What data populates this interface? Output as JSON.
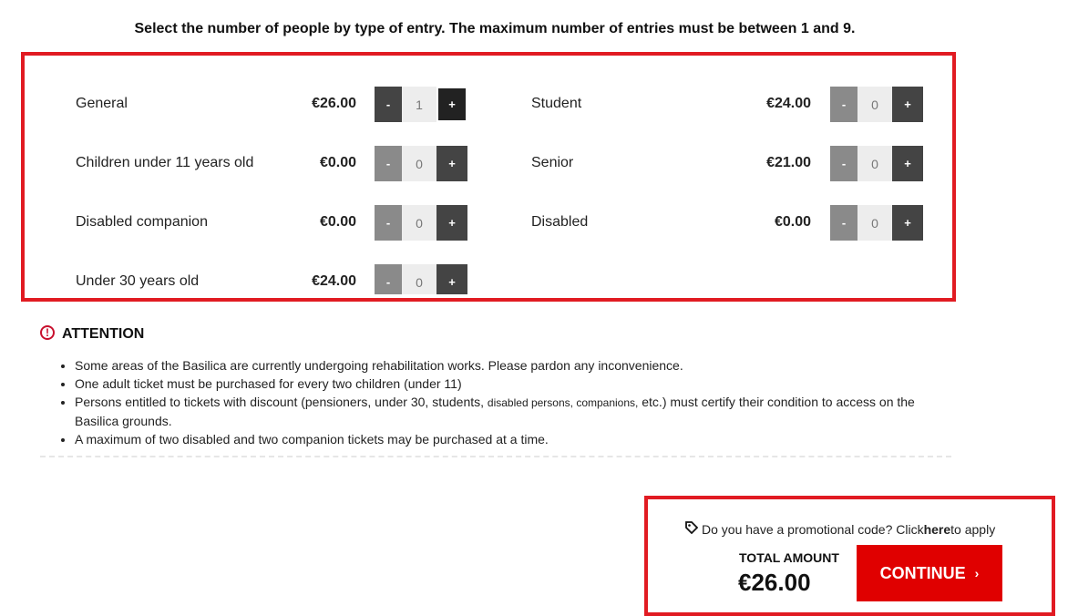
{
  "instructions": "Select the number of people by type of entry. The maximum number of entries must be between 1 and 9.",
  "tickets": [
    {
      "label": "General",
      "price": "€26.00",
      "qty": "1",
      "dec": "-",
      "inc": "+"
    },
    {
      "label": "Children under 11 years old",
      "price": "€0.00",
      "qty": "0",
      "dec": "-",
      "inc": "+"
    },
    {
      "label": "Disabled companion",
      "price": "€0.00",
      "qty": "0",
      "dec": "-",
      "inc": "+"
    },
    {
      "label": "Under 30 years old",
      "price": "€24.00",
      "qty": "0",
      "dec": "-",
      "inc": "+"
    },
    {
      "label": "Student",
      "price": "€24.00",
      "qty": "0",
      "dec": "-",
      "inc": "+"
    },
    {
      "label": "Senior",
      "price": "€21.00",
      "qty": "0",
      "dec": "-",
      "inc": "+"
    },
    {
      "label": "Disabled",
      "price": "€0.00",
      "qty": "0",
      "dec": "-",
      "inc": "+"
    }
  ],
  "attention": {
    "icon": "alert-circle-icon",
    "title": "ATTENTION",
    "notes": [
      "Some areas of the Basilica are currently undergoing rehabilitation works. Please pardon any inconvenience.",
      "One adult ticket must be purchased for every two children (under 11)",
      {
        "pre": "Persons entitled to tickets with discount (pensioners, under 30, students, ",
        "small": "disabled persons, companions,",
        "post": " etc.) must certify their condition to access on the Basilica grounds."
      },
      "A maximum of two disabled and two companion tickets may be purchased at a time."
    ]
  },
  "summary": {
    "promo_icon": "tag-icon",
    "promo_pre": "Do you have a promotional code? Click ",
    "promo_link": "here",
    "promo_post": " to apply",
    "total_label": "TOTAL AMOUNT",
    "total_value": "€26.00",
    "continue_label": "CONTINUE",
    "continue_icon": "chevron-right-icon"
  },
  "colors": {
    "accent": "#e11b22",
    "button": "#e00000",
    "stepper_dark": "#444444",
    "stepper_disabled": "#8a8a8a"
  }
}
